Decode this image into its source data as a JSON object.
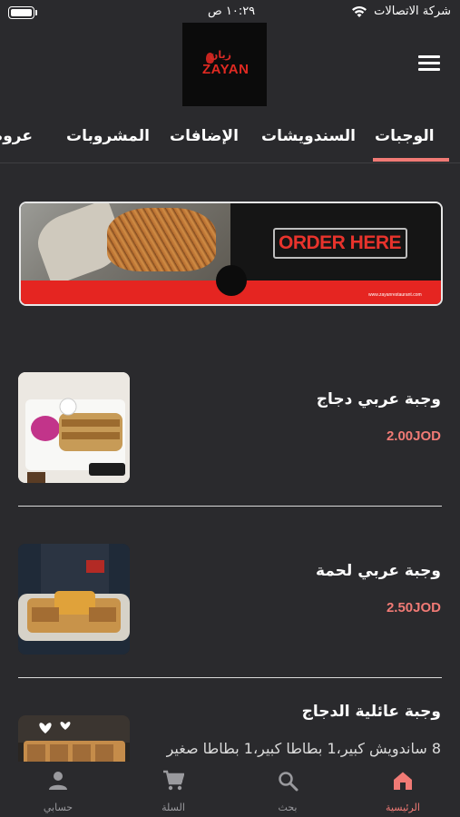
{
  "status": {
    "carrier": "شركة الاتصالات",
    "time": "١٠:٢٩ ص"
  },
  "logo": {
    "arabic": "زيان",
    "english": "ZAYAN"
  },
  "tabs": [
    {
      "label": "الوجبات"
    },
    {
      "label": "السندويشات"
    },
    {
      "label": "الإضافات"
    },
    {
      "label": "المشروبات"
    },
    {
      "label": "عروض"
    }
  ],
  "banner": {
    "cta": "ORDER HERE",
    "url": "www.zayanrestaurant.com"
  },
  "items": [
    {
      "name": "وجبة عربي دجاج",
      "price": "2.00JOD"
    },
    {
      "name": "وجبة عربي لحمة",
      "price": "2.50JOD"
    },
    {
      "name": "وجبة عائلية الدجاج",
      "desc": "8 ساندويش كبير،1 بطاطا كبير،1 بطاطا صغير"
    }
  ],
  "nav": [
    {
      "label": "الرئيسية",
      "icon": "home-icon"
    },
    {
      "label": "بحث",
      "icon": "search-icon"
    },
    {
      "label": "السلة",
      "icon": "cart-icon"
    },
    {
      "label": "حسابي",
      "icon": "person-icon"
    }
  ],
  "colors": {
    "accent": "#f07a75",
    "background": "#2a2a2d",
    "brand_red": "#e52521"
  }
}
